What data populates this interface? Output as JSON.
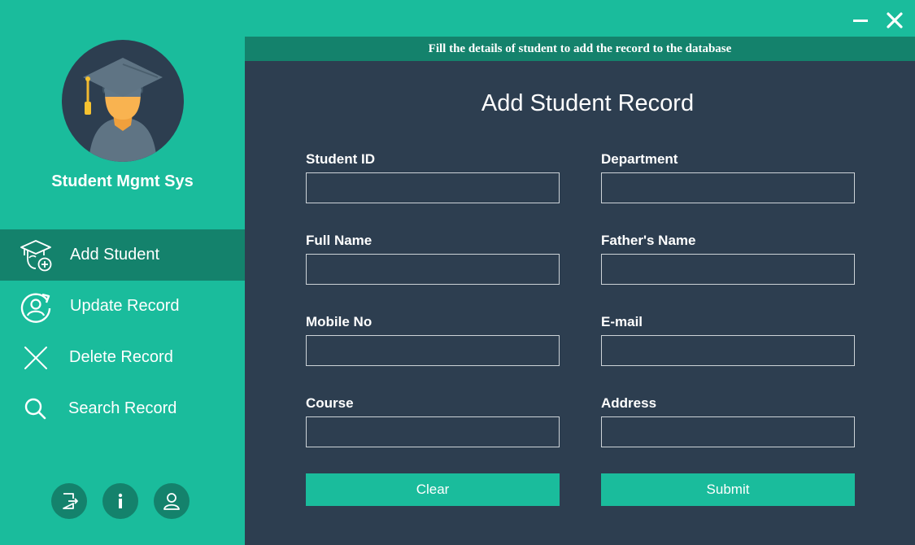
{
  "sidebar": {
    "app_title": "Student Mgmt Sys",
    "items": [
      {
        "label": "Add Student",
        "icon": "graduate-add-icon",
        "active": true
      },
      {
        "label": "Update Record",
        "icon": "refresh-user-icon",
        "active": false
      },
      {
        "label": "Delete Record",
        "icon": "close-icon",
        "active": false
      },
      {
        "label": "Search Record",
        "icon": "search-icon",
        "active": false
      }
    ],
    "bottom_icons": [
      "logout-icon",
      "info-icon",
      "user-icon"
    ]
  },
  "header": {
    "banner_text": "Fill the details of student to add the record to the database"
  },
  "form": {
    "title": "Add Student Record",
    "fields": {
      "student_id": {
        "label": "Student ID",
        "value": ""
      },
      "department": {
        "label": "Department",
        "value": ""
      },
      "full_name": {
        "label": "Full Name",
        "value": ""
      },
      "fathers_name": {
        "label": "Father's Name",
        "value": ""
      },
      "mobile_no": {
        "label": "Mobile No",
        "value": ""
      },
      "email": {
        "label": "E-mail",
        "value": ""
      },
      "course": {
        "label": "Course",
        "value": ""
      },
      "address": {
        "label": "Address",
        "value": ""
      }
    },
    "clear_label": "Clear",
    "submit_label": "Submit"
  },
  "colors": {
    "accent": "#1abc9c",
    "accent_dark": "#14826c",
    "panel": "#2d3e50"
  }
}
